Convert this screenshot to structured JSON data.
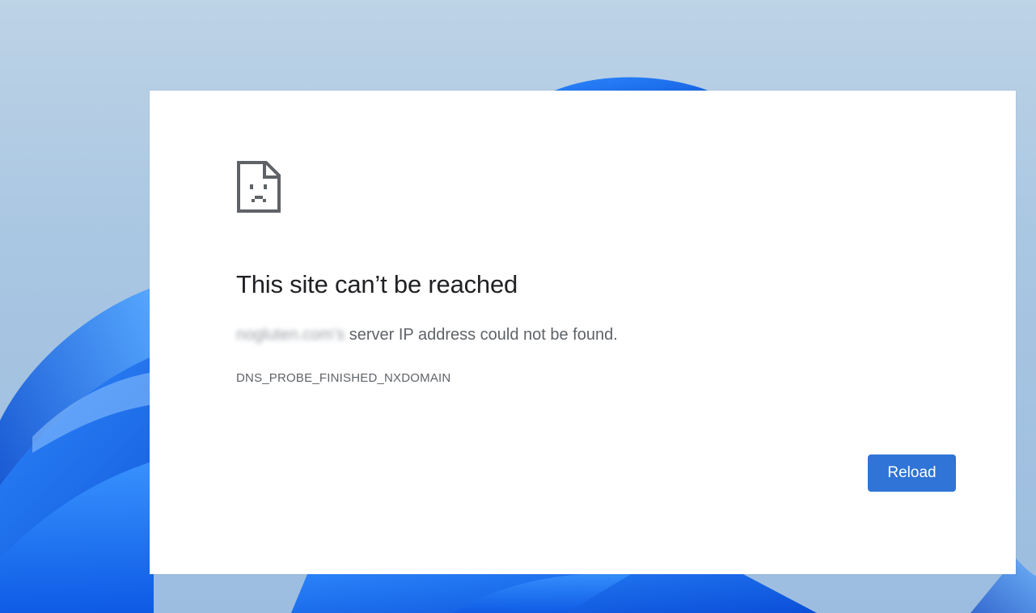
{
  "error_page": {
    "title": "This site can’t be reached",
    "message_domain": "nogluten.com’s",
    "message_text": " server IP address could not be found.",
    "error_code": "DNS_PROBE_FINISHED_NXDOMAIN",
    "reload_label": "Reload",
    "icon": "sad-page-icon"
  },
  "colors": {
    "accent": "#2f74d6",
    "title_text": "#202124",
    "body_text": "#5f6368",
    "page_background": "#ffffff"
  }
}
